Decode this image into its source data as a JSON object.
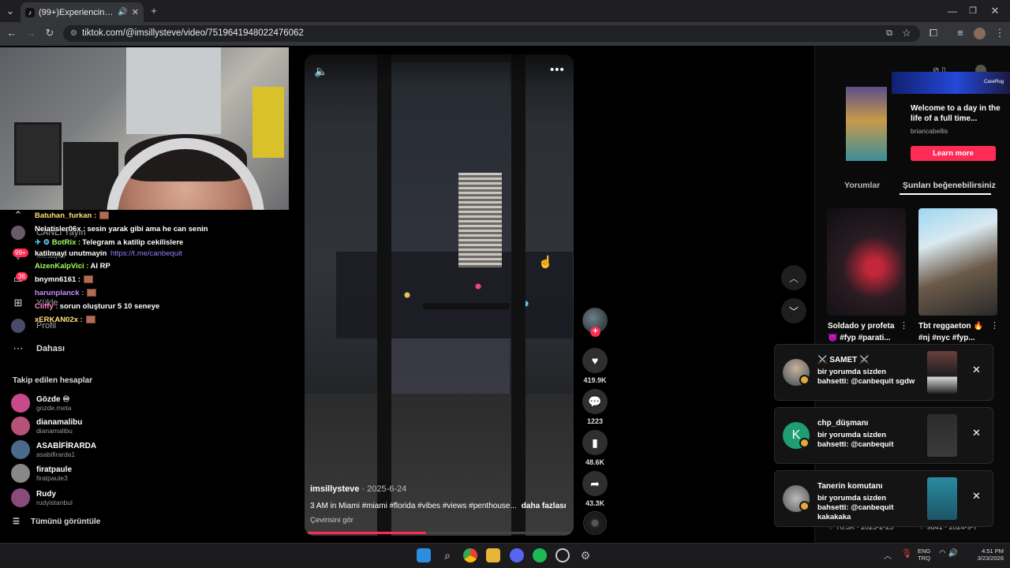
{
  "browser": {
    "tab_title": "(99+)Experiencing 3 AM Vi",
    "tab_icon": "tiktok-icon",
    "url": "tiktok.com/@imsillysteve/video/7519641948022476062"
  },
  "sidebar": {
    "chat": [
      {
        "user": "Batuhan_furkan :",
        "user_color": "#ffe07a",
        "text": ""
      },
      {
        "user": "Nelatisler06x :",
        "user_color": "#ffffff",
        "text": "sesin yarak gibi ama he can senin"
      },
      {
        "user": "BotRix :",
        "user_color": "#a0ff60",
        "text": "Telegram a katilip cekilislere"
      },
      {
        "user": "katilmayi unutmayin",
        "user_color": "#ffffff",
        "text": "",
        "link": "https://t.me/canbequit"
      },
      {
        "user": "AizenKalpVici :",
        "user_color": "#a0ff60",
        "text": "AI RP"
      },
      {
        "user": "bnymn6161 :",
        "user_color": "#ffffff",
        "text": ""
      },
      {
        "user": "harunplanck :",
        "user_color": "#c78dff",
        "text": ""
      },
      {
        "user": "Cliffy :",
        "user_color": "#ff8ad0",
        "text": "sorun oluşturur 5 10 seneye"
      },
      {
        "user": "xERKAN02x :",
        "user_color": "#ffe07a",
        "text": ""
      }
    ],
    "nav": {
      "live_label": "CANLI Yayın",
      "messages_label": "Mesajlar",
      "upload_label": "Yükle",
      "profile_label": "Profil",
      "more_label": "Dahası",
      "badge_99": "99+",
      "badge_36": "36"
    },
    "following_title": "Takip edilen hesaplar",
    "following": [
      {
        "name": "Gözde ♾",
        "handle": "gozde.meta",
        "color": "#c94a8a"
      },
      {
        "name": "dianamalibu",
        "handle": "dianamalibu",
        "color": "#b6527a"
      },
      {
        "name": "ASABİFİRARDA",
        "handle": "asabifirarda1",
        "color": "#4b6a8a"
      },
      {
        "name": "firatpaule",
        "handle": "firatpaule3",
        "color": "#888888"
      },
      {
        "name": "Rudy",
        "handle": "rudyistanbul",
        "color": "#8a4a7a"
      }
    ],
    "see_all": "Tümünü görüntüle"
  },
  "video": {
    "author": "imsillysteve",
    "date": " · 2025-6-24",
    "caption": "3 AM in Miami #miami #florida #vibes #views #penthouse...",
    "more": "daha fazlası",
    "translate": "Çevirisini gör",
    "progress": 0.45
  },
  "actions": {
    "likes": "419.9K",
    "comments": "1223",
    "saves": "48.6K",
    "shares": "43.3K"
  },
  "ad": {
    "banner_text": "CaseRug",
    "title": "Welcome to a day in the life of a full time...",
    "handle": "briancabellis",
    "cta": "Learn more"
  },
  "right_tabs": {
    "comments": "Yorumlar",
    "you_may_like": "Şunları beğenebilirsiniz"
  },
  "recommendations": [
    {
      "title": "Soldado y profeta",
      "tags": "👿 #fyp #parati...",
      "stat_likes": "70.5K",
      "stat_date": "2025-2-25"
    },
    {
      "title": "Tbt reggaeton 🔥",
      "tags": "#nj #nyc #fyp...",
      "stat_likes": "9841",
      "stat_date": "2024-9-7"
    }
  ],
  "notifications": [
    {
      "name": "⚔️ SAMET ⚔️",
      "text": "bir yorumda sizden bahsetti: @canbequit sgdw",
      "avatar_color": "#7a8aa0",
      "thumb_color": "#6a3f3f"
    },
    {
      "name": "chp_düşmanı",
      "text": "bir yorumda sizden bahsetti: @canbequit",
      "avatar_color": "#1e9e72",
      "avatar_letter": "K",
      "thumb_color": "#2c2c2c"
    },
    {
      "name": "Tanerin komutanı",
      "text": "bir yorumda sizden bahsetti: @canbequit kakakaka",
      "avatar_color": "#8a8a8a",
      "thumb_color": "#2a8aa0"
    }
  ],
  "taskbar": {
    "lang_top": "ENG",
    "lang_bottom": "TRQ",
    "time": "4:51 PM",
    "date": "3/23/2026"
  }
}
